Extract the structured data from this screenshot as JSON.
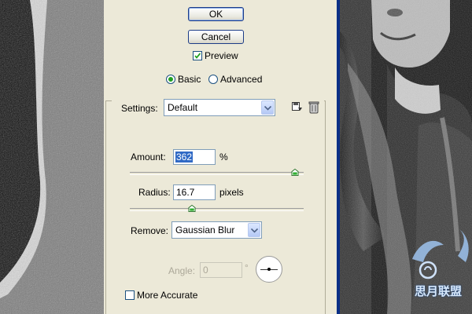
{
  "dialog": {
    "ok_label": "OK",
    "cancel_label": "Cancel",
    "preview_label": "Preview",
    "preview_checked": true,
    "mode_basic_label": "Basic",
    "mode_advanced_label": "Advanced",
    "mode_selected": "Basic"
  },
  "settings": {
    "label": "Settings:",
    "value": "Default",
    "save_icon": "save-preset-icon",
    "delete_icon": "trash-icon"
  },
  "amount": {
    "label": "Amount:",
    "value": "362",
    "unit": "%",
    "slider_fraction": 0.91
  },
  "radius": {
    "label": "Radius:",
    "value": "16.7",
    "unit": "pixels",
    "slider_fraction": 0.32
  },
  "remove": {
    "label": "Remove:",
    "value": "Gaussian Blur"
  },
  "angle": {
    "label": "Angle:",
    "value": "0",
    "unit": "°"
  },
  "more_accurate": {
    "label": "More Accurate",
    "checked": false
  },
  "watermark": {
    "text": "思月联盟"
  },
  "colors": {
    "dialog_bg": "#ece9d8",
    "selection": "#316ac5",
    "radio_dot": "#21a121",
    "image_border": "#0a2f87"
  }
}
